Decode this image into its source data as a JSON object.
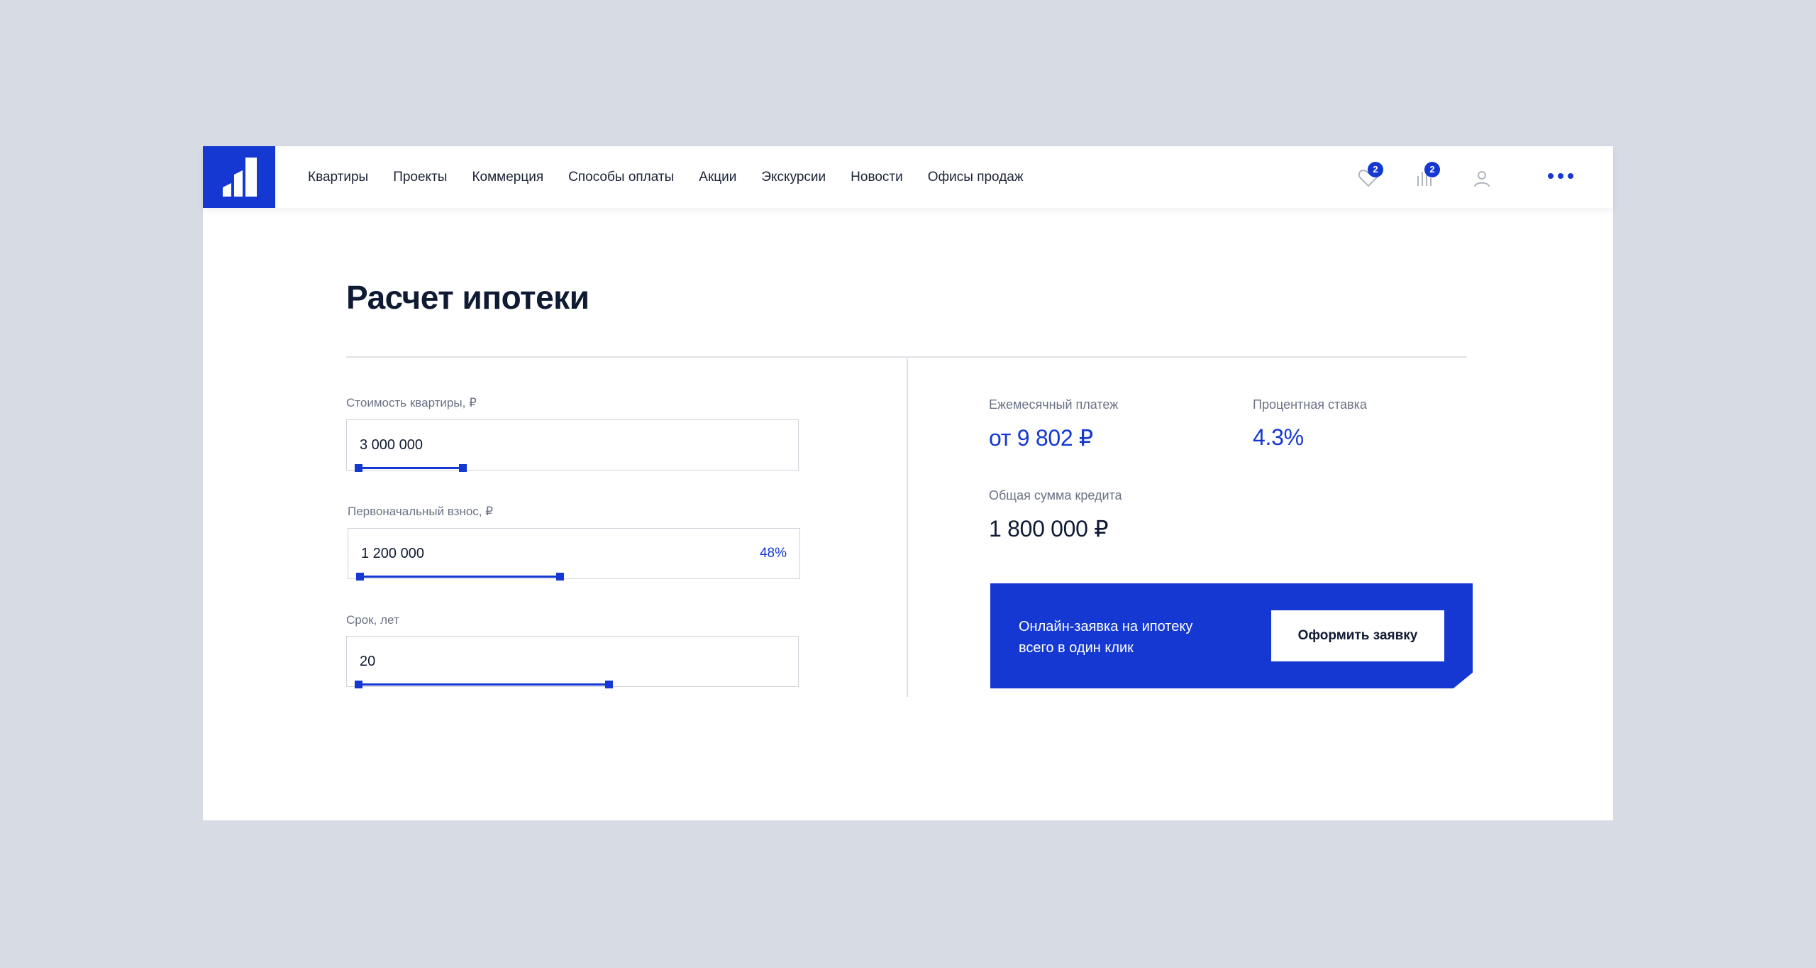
{
  "nav": {
    "items": [
      {
        "label": "Квартиры"
      },
      {
        "label": "Проекты"
      },
      {
        "label": "Коммерция"
      },
      {
        "label": "Способы оплаты"
      },
      {
        "label": "Акции"
      },
      {
        "label": "Экскурсии"
      },
      {
        "label": "Новости"
      },
      {
        "label": "Офисы продаж"
      }
    ],
    "favorites_count": "2",
    "compare_count": "2",
    "icons": [
      "heart-icon",
      "chart-icon",
      "user-icon",
      "more-icon"
    ]
  },
  "calc": {
    "title": "Расчет ипотеки",
    "price": {
      "label": "Стоимость квартиры, ₽",
      "value": "3 000 000",
      "level": 0.25
    },
    "down": {
      "label": "Первоначальный взнос, ₽",
      "value": "1 200 000",
      "percent": "48%",
      "level": 0.48
    },
    "term": {
      "label": "Срок, лет",
      "value": "20",
      "level": 0.6
    }
  },
  "results": {
    "monthly_label": "Ежемесячный платеж",
    "monthly_value": "от 9 802 ₽",
    "rate_label": "Процентная ставка",
    "rate_value": "4.3%",
    "total_label": "Общая сумма кредита",
    "total_value": "1 800 000 ₽"
  },
  "promo": {
    "line1": "Онлайн-заявка на ипотеку",
    "line2": "всего в один клик",
    "button": "Оформить заявку"
  },
  "colors": {
    "accent": "#1438d1",
    "background": "#d6dbe4",
    "text": "#0f1a33",
    "muted": "#6b7285"
  }
}
